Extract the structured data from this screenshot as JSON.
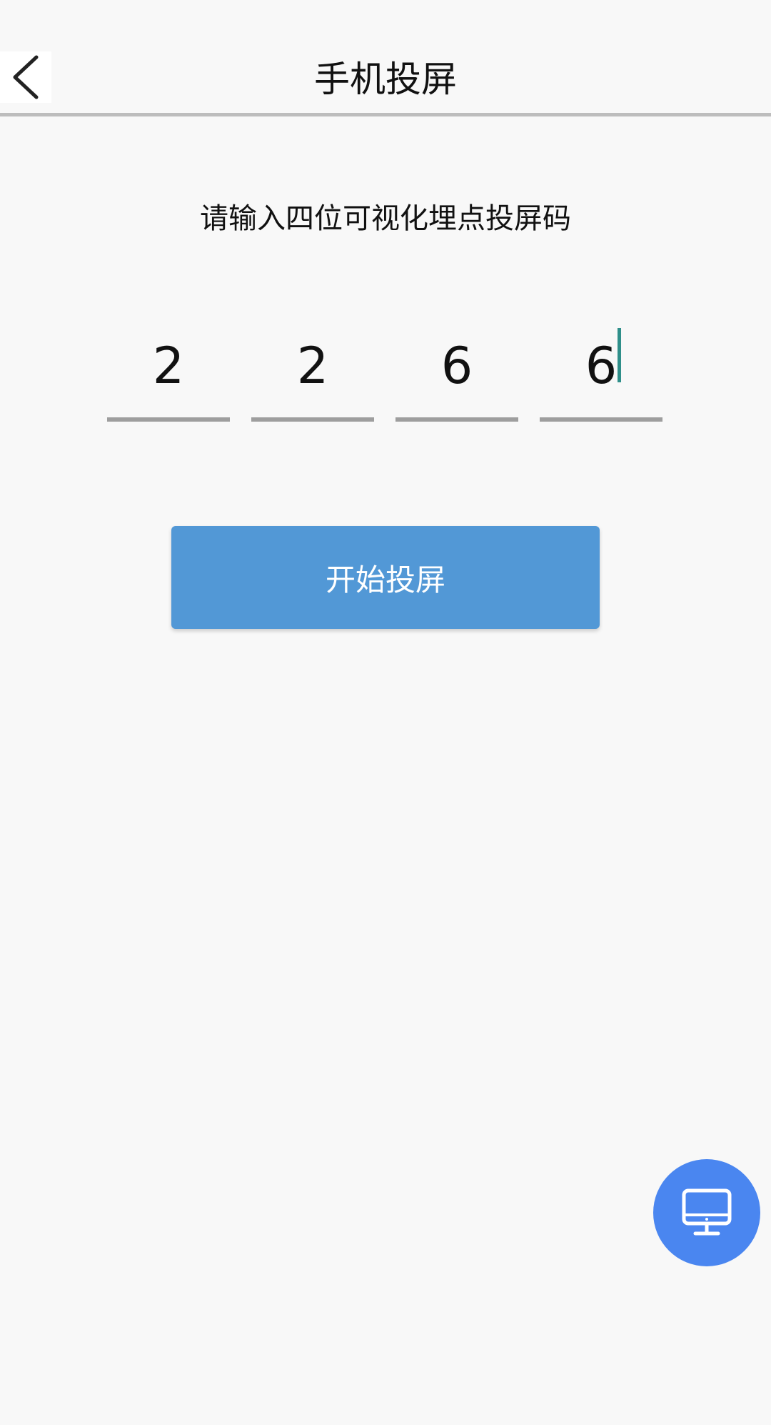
{
  "header": {
    "title": "手机投屏",
    "back_icon": "chevron-left-icon"
  },
  "prompt": "请输入四位可视化埋点投屏码",
  "code": {
    "digits": [
      "2",
      "2",
      "6",
      "6"
    ],
    "active_index": 3
  },
  "start_button": {
    "label": "开始投屏"
  },
  "fab": {
    "icon": "monitor-icon"
  },
  "colors": {
    "background": "#f8f8f8",
    "button": "#5298d6",
    "fab": "#4a86f0",
    "underline": "#9e9e9e",
    "cursor": "#2f8f8a"
  }
}
